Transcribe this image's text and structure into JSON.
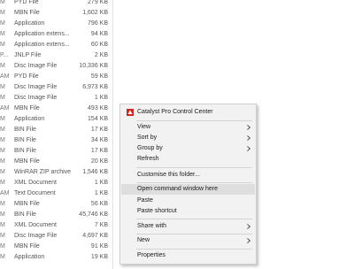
{
  "files": [
    {
      "m": "M",
      "type": "PYD File",
      "size": "279 KB"
    },
    {
      "m": "M",
      "type": "MBN File",
      "size": "1,602 KB"
    },
    {
      "m": "M",
      "type": "Application",
      "size": "796 KB"
    },
    {
      "m": "M",
      "type": "Application extens...",
      "size": "94 KB"
    },
    {
      "m": "M",
      "type": "Application extens...",
      "size": "60 KB"
    },
    {
      "m": "P...",
      "type": "JNLP File",
      "size": "2 KB"
    },
    {
      "m": "M",
      "type": "Disc Image File",
      "size": "10,336 KB"
    },
    {
      "m": "AM",
      "type": "PYD File",
      "size": "59 KB"
    },
    {
      "m": "M",
      "type": "Disc Image File",
      "size": "6,973 KB"
    },
    {
      "m": "M",
      "type": "Disc Image File",
      "size": "1 KB"
    },
    {
      "m": "AM",
      "type": "MBN File",
      "size": "493 KB"
    },
    {
      "m": "M",
      "type": "Application",
      "size": "154 KB"
    },
    {
      "m": "M",
      "type": "BIN File",
      "size": "17 KB"
    },
    {
      "m": "M",
      "type": "BIN File",
      "size": "34 KB"
    },
    {
      "m": "M",
      "type": "BIN File",
      "size": "17 KB"
    },
    {
      "m": "M",
      "type": "MBN File",
      "size": "20 KB"
    },
    {
      "m": "M",
      "type": "WinRAR ZIP archive",
      "size": "1,546 KB"
    },
    {
      "m": "M",
      "type": "XML Document",
      "size": "1 KB"
    },
    {
      "m": "AM",
      "type": "Text Document",
      "size": "1 KB"
    },
    {
      "m": "M",
      "type": "MBN File",
      "size": "56 KB"
    },
    {
      "m": "M",
      "type": "BIN File",
      "size": "45,746 KB"
    },
    {
      "m": "M",
      "type": "XML Document",
      "size": "7 KB"
    },
    {
      "m": "M",
      "type": "Disc Image File",
      "size": "4,697 KB"
    },
    {
      "m": "M",
      "type": "MBN File",
      "size": "91 KB"
    },
    {
      "m": "M",
      "type": "Application",
      "size": "19 KB"
    }
  ],
  "context_menu": {
    "title_item": "Catalyst Pro Control Center",
    "view": "View",
    "sort_by": "Sort by",
    "group_by": "Group by",
    "refresh": "Refresh",
    "customise": "Customise this folder...",
    "open_cmd": "Open command window here",
    "paste": "Paste",
    "paste_shortcut": "Paste shortcut",
    "share_with": "Share with",
    "new": "New",
    "properties": "Properties",
    "icons": {
      "catalyst": "catalyst-logo-icon",
      "submenu": "chevron-right-icon"
    },
    "colors": {
      "highlight": "#dedede",
      "menu_bg": "#f2f2f2",
      "catalyst_red": "#d0281e"
    }
  }
}
